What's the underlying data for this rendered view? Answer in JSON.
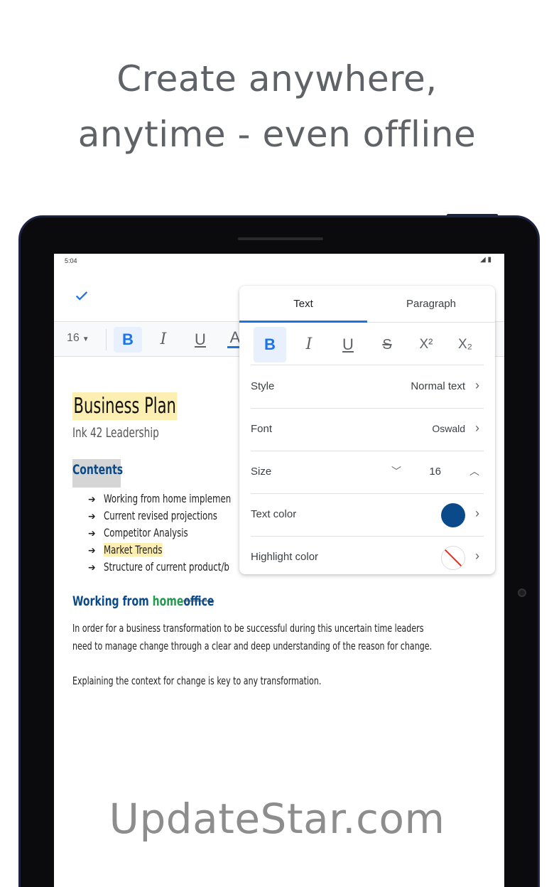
{
  "headline": {
    "line1": "Create anywhere,",
    "line2": "anytime - even offline"
  },
  "status": {
    "time": "5:04",
    "icons": "◢ ▮"
  },
  "editor": {
    "confirm_icon": "check-icon",
    "toolbar": {
      "font_size": "16",
      "bold": "B",
      "italic": "I",
      "underline": "U",
      "text_color": "A"
    }
  },
  "document": {
    "title": "Business Plan",
    "subtitle": "Ink 42 Leadership",
    "contents_heading": "Contents",
    "items": [
      {
        "text": "Working from home implemen"
      },
      {
        "text": "Current revised projections"
      },
      {
        "text": "Competitor Analysis"
      },
      {
        "text": "Market Trends"
      },
      {
        "text": "Structure of current product/b"
      }
    ],
    "arrow": "➔",
    "section_heading_prefix": "Working from ",
    "section_heading_green": "home",
    "section_heading_strike": "office",
    "paragraph1_line1": "In order for a business transformation to be successful during this uncertain time leaders",
    "paragraph1_line2": "need to manage change through a clear and deep understanding of the reason for change.",
    "paragraph2": "Explaining the context for change is key to any transformation."
  },
  "format_panel": {
    "tabs": [
      {
        "label": "Text",
        "selected": true
      },
      {
        "label": "Paragraph",
        "selected": false
      }
    ],
    "buttons": {
      "bold": "B",
      "italic": "I",
      "underline": "U",
      "strikethrough": "S",
      "superscript": "X²",
      "subscript": "X₂"
    },
    "rows": {
      "style": {
        "label": "Style",
        "value": "Normal text"
      },
      "font": {
        "label": "Font",
        "value": "Oswald"
      },
      "size": {
        "label": "Size",
        "value": "16"
      },
      "text_color": {
        "label": "Text color",
        "color": "#0b4a8a"
      },
      "highlight_color": {
        "label": "Highlight color",
        "color": "none"
      }
    },
    "accent_color": "#1a73e8"
  },
  "watermark": "UpdateStar.com"
}
